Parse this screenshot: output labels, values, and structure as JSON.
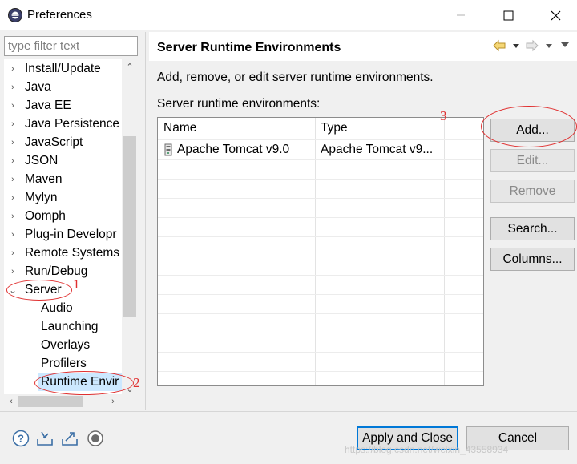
{
  "window": {
    "title": "Preferences"
  },
  "filter": {
    "placeholder": "type filter text"
  },
  "tree": {
    "items": [
      {
        "label": "Install/Update",
        "expandable": true
      },
      {
        "label": "Java",
        "expandable": true
      },
      {
        "label": "Java EE",
        "expandable": true
      },
      {
        "label": "Java Persistence",
        "expandable": true
      },
      {
        "label": "JavaScript",
        "expandable": true
      },
      {
        "label": "JSON",
        "expandable": true
      },
      {
        "label": "Maven",
        "expandable": true
      },
      {
        "label": "Mylyn",
        "expandable": true
      },
      {
        "label": "Oomph",
        "expandable": true
      },
      {
        "label": "Plug-in Developr",
        "expandable": true
      },
      {
        "label": "Remote Systems",
        "expandable": true
      },
      {
        "label": "Run/Debug",
        "expandable": true
      },
      {
        "label": "Server",
        "expandable": true,
        "expanded": true
      },
      {
        "label": "Audio",
        "child": true
      },
      {
        "label": "Launching",
        "child": true
      },
      {
        "label": "Overlays",
        "child": true
      },
      {
        "label": "Profilers",
        "child": true
      },
      {
        "label": "Runtime Envir",
        "child": true,
        "selected": true
      }
    ]
  },
  "page": {
    "title": "Server Runtime Environments",
    "description": "Add, remove, or edit server runtime environments.",
    "list_label": "Server runtime environments:",
    "table": {
      "columns": [
        "Name",
        "Type"
      ],
      "rows": [
        {
          "name": "Apache Tomcat v9.0",
          "type": "Apache Tomcat v9..."
        }
      ]
    },
    "buttons": {
      "add": "Add...",
      "edit": "Edit...",
      "remove": "Remove",
      "search": "Search...",
      "columns": "Columns..."
    }
  },
  "footer": {
    "apply_close": "Apply and Close",
    "cancel": "Cancel"
  },
  "annotations": [
    "1",
    "2",
    "3"
  ],
  "watermark": "https://blog.csdn.net/weixin_43558934",
  "colors": {
    "accent": "#0078d7",
    "annotation": "#e03030",
    "selection": "#cce8ff"
  }
}
